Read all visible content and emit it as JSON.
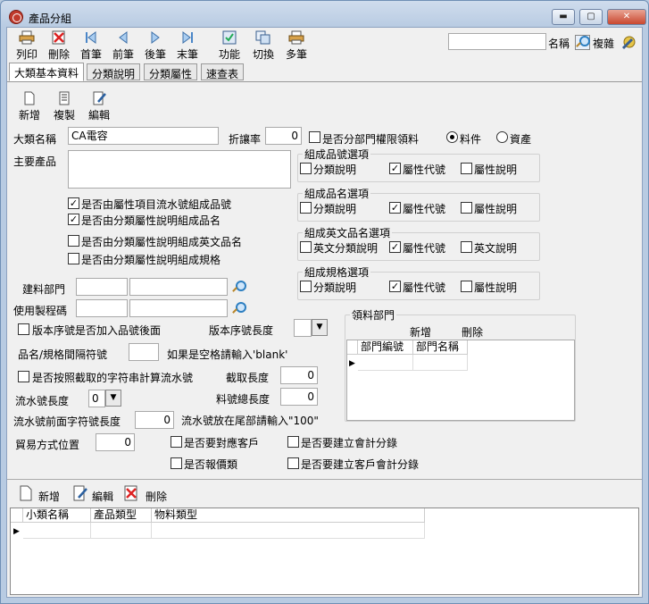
{
  "window": {
    "title": "產品分組",
    "btn_min": "▬",
    "btn_max": "▢",
    "btn_close": "✕"
  },
  "toolbar": {
    "print": "列印",
    "delete": "刪除",
    "first": "首筆",
    "prev": "前筆",
    "next": "後筆",
    "last": "末筆",
    "func": "功能",
    "switch": "切換",
    "multi": "多筆",
    "name_label": "名稱",
    "complex": "複雜",
    "search_value": ""
  },
  "tabs": [
    "大類基本資料",
    "分類說明",
    "分類屬性",
    "速查表"
  ],
  "subtoolbar": {
    "add": "新增",
    "copy": "複製",
    "edit": "編輯"
  },
  "form": {
    "category_name_label": "大類名稱",
    "category_name_value": "CA電容",
    "discount_label": "折讓率",
    "discount_value": "0",
    "dept_perm_label": "是否分部門權限領料",
    "radio_material": "料件",
    "radio_asset": "資產",
    "main_product_label": "主要產品",
    "check1": "是否由屬性項目流水號組成品號",
    "check2": "是否由分類屬性說明組成品名",
    "check3": "是否由分類屬性說明組成英文品名",
    "check4": "是否由分類屬性說明組成規格",
    "build_dept_label": "建料部門",
    "use_code_label": "使用製程碼",
    "version_suffix_label": "版本序號是否加入品號後面",
    "version_len_label": "版本序號長度",
    "name_sep_label": "品名/規格間隔符號",
    "name_sep_hint": "如果是空格請輸入'blank'",
    "cut_by_char_label": "是否按照截取的字符串計算流水號",
    "cut_len_label": "截取長度",
    "cut_len_value": "0",
    "serial_len_label": "流水號長度",
    "serial_len_value": "0",
    "total_len_label": "料號總長度",
    "total_len_value": "0",
    "serial_prefix_len_label": "流水號前面字符號長度",
    "serial_prefix_len_value": "0",
    "serial_suffix_hint": "流水號放在尾部請輸入\"100\"",
    "trade_pos_label": "貿易方式位置",
    "trade_pos_value": "0",
    "match_customer": "是否要對應客戶",
    "need_quote": "是否報價類",
    "create_sub_acct": "是否要建立會計分錄",
    "create_cust_acct": "是否要建立客戶會計分錄"
  },
  "groups": {
    "part_no": {
      "title": "組成品號選項",
      "o1": "分類說明",
      "o2": "屬性代號",
      "o3": "屬性說明"
    },
    "part_name": {
      "title": "組成品名選項",
      "o1": "分類說明",
      "o2": "屬性代號",
      "o3": "屬性說明"
    },
    "eng_name": {
      "title": "組成英文品名選項",
      "o1": "英文分類說明",
      "o2": "屬性代號",
      "o3": "英文說明"
    },
    "spec": {
      "title": "組成規格選項",
      "o1": "分類說明",
      "o2": "屬性代號",
      "o3": "屬性說明"
    }
  },
  "dept_panel": {
    "title": "領料部門",
    "add": "新增",
    "delete": "刪除",
    "col1": "部門編號",
    "col2": "部門名稱"
  },
  "bottom": {
    "add": "新增",
    "edit": "編輯",
    "delete": "刪除",
    "col1": "小類名稱",
    "col2": "產品類型",
    "col3": "物料類型"
  }
}
